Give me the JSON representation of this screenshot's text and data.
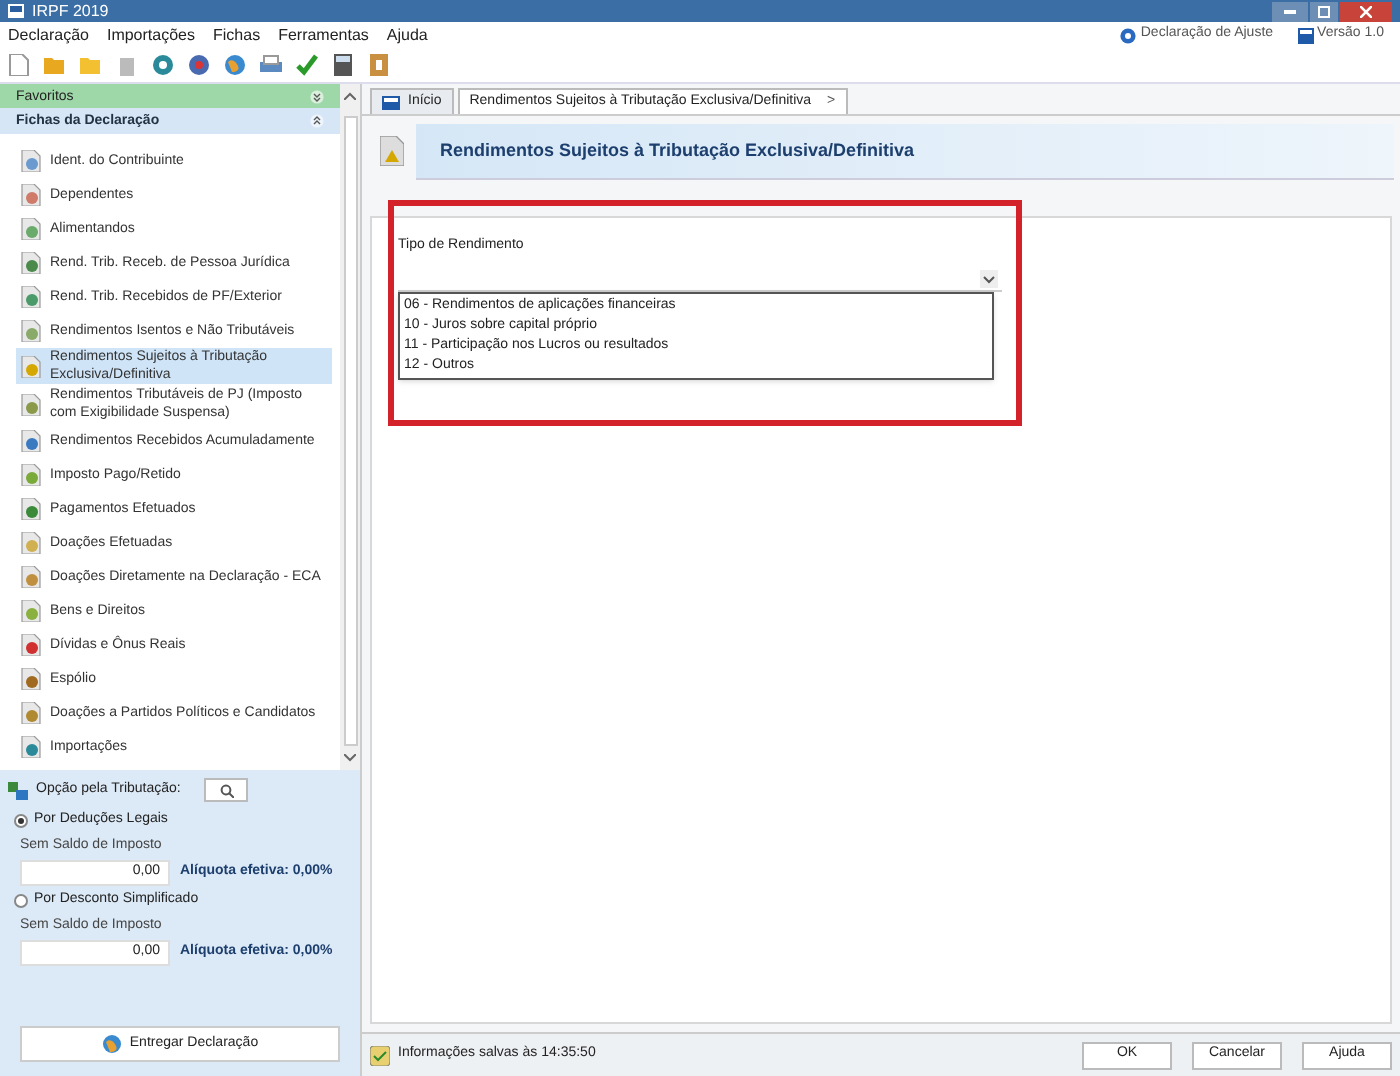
{
  "window": {
    "title": "IRPF 2019"
  },
  "menu": [
    "Declaração",
    "Importações",
    "Fichas",
    "Ferramentas",
    "Ajuda"
  ],
  "header_links": [
    {
      "label": "Declaração de Ajuste"
    },
    {
      "label": "Versão 1.0"
    }
  ],
  "sidebar": {
    "favorites": "Favoritos",
    "section": "Fichas da Declaração",
    "items": [
      {
        "label": "Ident. do Contribuinte",
        "selected": false
      },
      {
        "label": "Dependentes",
        "selected": false
      },
      {
        "label": "Alimentandos",
        "selected": false
      },
      {
        "label": "Rend. Trib. Receb. de Pessoa Jurídica",
        "selected": false
      },
      {
        "label": "Rend. Trib. Recebidos de PF/Exterior",
        "selected": false
      },
      {
        "label": "Rendimentos Isentos e Não Tributáveis",
        "selected": false
      },
      {
        "label": "Rendimentos Sujeitos à Tributação Exclusiva/Definitiva",
        "selected": true
      },
      {
        "label": "Rendimentos Tributáveis de PJ (Imposto com Exigibilidade Suspensa)",
        "selected": false
      },
      {
        "label": "Rendimentos Recebidos Acumuladamente",
        "selected": false
      },
      {
        "label": "Imposto Pago/Retido",
        "selected": false
      },
      {
        "label": "Pagamentos Efetuados",
        "selected": false
      },
      {
        "label": "Doações Efetuadas",
        "selected": false
      },
      {
        "label": "Doações Diretamente na Declaração - ECA",
        "selected": false
      },
      {
        "label": "Bens e Direitos",
        "selected": false
      },
      {
        "label": "Dívidas e Ônus Reais",
        "selected": false
      },
      {
        "label": "Espólio",
        "selected": false
      },
      {
        "label": "Doações a Partidos Políticos e Candidatos",
        "selected": false
      },
      {
        "label": "Importações",
        "selected": false
      }
    ]
  },
  "taxation": {
    "title": "Opção pela Tributação:",
    "options": [
      {
        "label": "Por Deduções Legais",
        "selected": true,
        "balance_label": "Sem Saldo de Imposto",
        "value": "0,00",
        "rate": "Alíquota efetiva: 0,00%"
      },
      {
        "label": "Por Desconto Simplificado",
        "selected": false,
        "balance_label": "Sem Saldo de Imposto",
        "value": "0,00",
        "rate": "Alíquota efetiva: 0,00%"
      }
    ],
    "submit": "Entregar Declaração"
  },
  "tabs": [
    {
      "label": "Início",
      "selected": false
    },
    {
      "label": "Rendimentos Sujeitos à Tributação Exclusiva/Definitiva",
      "selected": true,
      "close": ">"
    }
  ],
  "form": {
    "title": "Rendimentos Sujeitos à Tributação Exclusiva/Definitiva",
    "field_label": "Tipo de Rendimento",
    "options": [
      "06 - Rendimentos de aplicações financeiras",
      "10 - Juros sobre capital próprio",
      "11 - Participação nos Lucros ou resultados",
      "12 - Outros"
    ]
  },
  "status": "Informações salvas às 14:35:50",
  "buttons": [
    "OK",
    "Cancelar",
    "Ajuda"
  ]
}
